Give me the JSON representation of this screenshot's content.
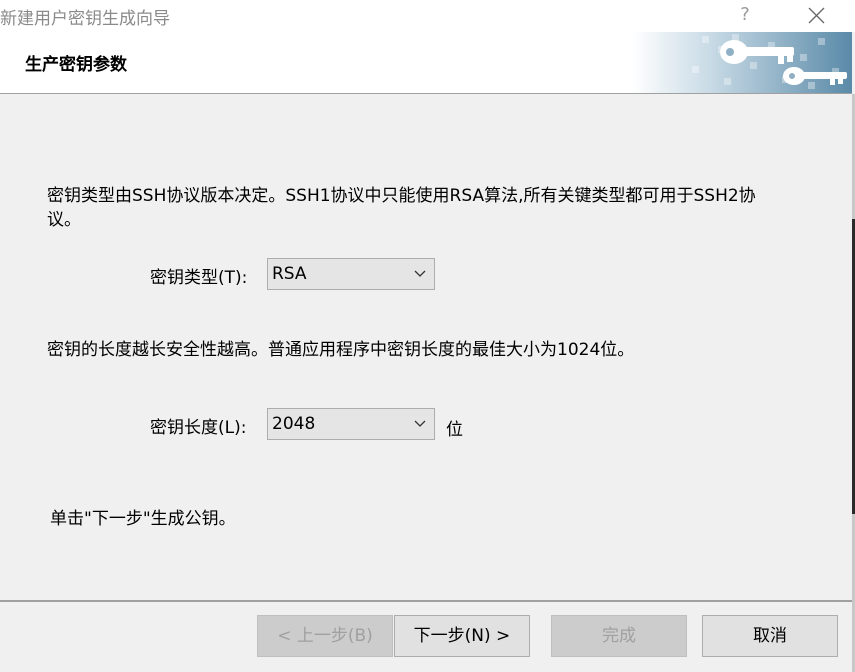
{
  "window": {
    "title": "新建用户密钥生成向导",
    "help_label": "?"
  },
  "header": {
    "title": "生产密钥参数"
  },
  "main": {
    "description": "密钥类型由SSH协议版本决定。SSH1协议中只能使用RSA算法,所有关键类型都可用于SSH2协",
    "description_cont": "议。",
    "key_type_label": "密钥类型(T):",
    "key_type_value": "RSA",
    "length_note": "密钥的长度越长安全性越高。普通应用程序中密钥长度的最佳大小为1024位。",
    "key_length_label": "密钥长度(L):",
    "key_length_value": "2048",
    "key_length_unit": "位",
    "instruction": "单击\"下一步\"生成公钥。"
  },
  "buttons": {
    "back": "< 上一步(B)",
    "next": "下一步(N) >",
    "finish": "完成",
    "cancel": "取消"
  }
}
